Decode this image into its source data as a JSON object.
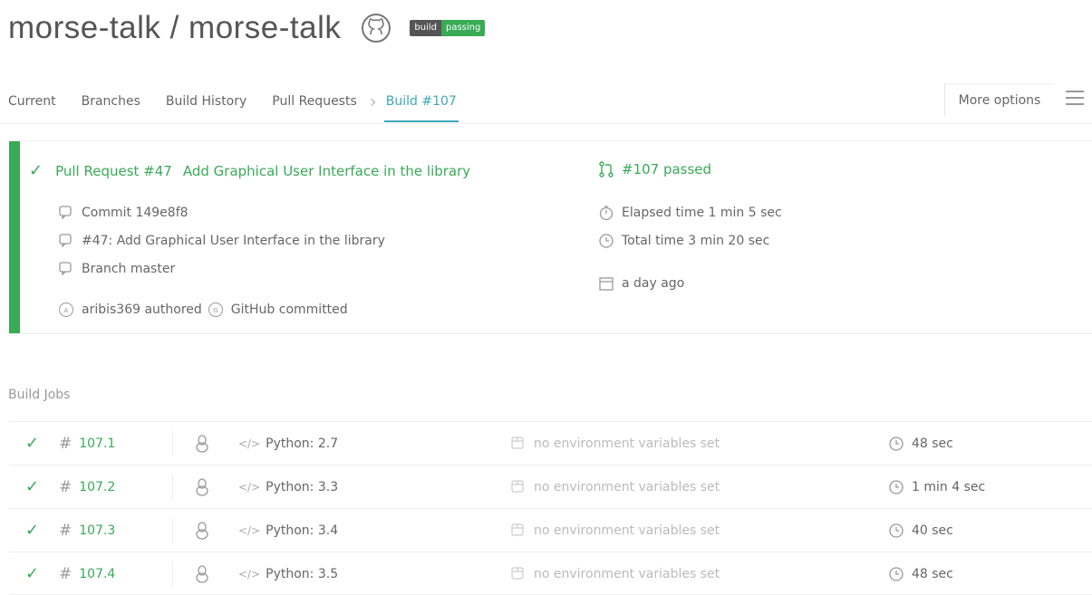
{
  "repo": {
    "title": "morse-talk / morse-talk",
    "badge_left": "build",
    "badge_right": "passing",
    "icon": "github-icon"
  },
  "nav": {
    "tabs": [
      "Current",
      "Branches",
      "Build History",
      "Pull Requests"
    ],
    "active_tab": "Build #107",
    "more_options": "More options"
  },
  "build": {
    "pr_label": "Pull Request #47",
    "pr_message": "Add Graphical User Interface in the library",
    "status": "#107 passed",
    "commit": "Commit 149e8f8",
    "pr_ref": "#47: Add Graphical User Interface in the library",
    "branch": "Branch master",
    "authored": "aribis369 authored",
    "committed": "GitHub committed",
    "elapsed": "Elapsed time 1 min 5 sec",
    "total": "Total time 3 min 20 sec",
    "date": "a day ago"
  },
  "jobs_title": "Build Jobs",
  "jobs": [
    {
      "number": "107.1",
      "language": "Python: 2.7",
      "env": "no environment variables set",
      "duration": "48 sec"
    },
    {
      "number": "107.2",
      "language": "Python: 3.3",
      "env": "no environment variables set",
      "duration": "1 min 4 sec"
    },
    {
      "number": "107.3",
      "language": "Python: 3.4",
      "env": "no environment variables set",
      "duration": "40 sec"
    },
    {
      "number": "107.4",
      "language": "Python: 3.5",
      "env": "no environment variables set",
      "duration": "48 sec"
    }
  ],
  "colors": {
    "success": "#39aa56",
    "accent": "#3ea6b8"
  }
}
